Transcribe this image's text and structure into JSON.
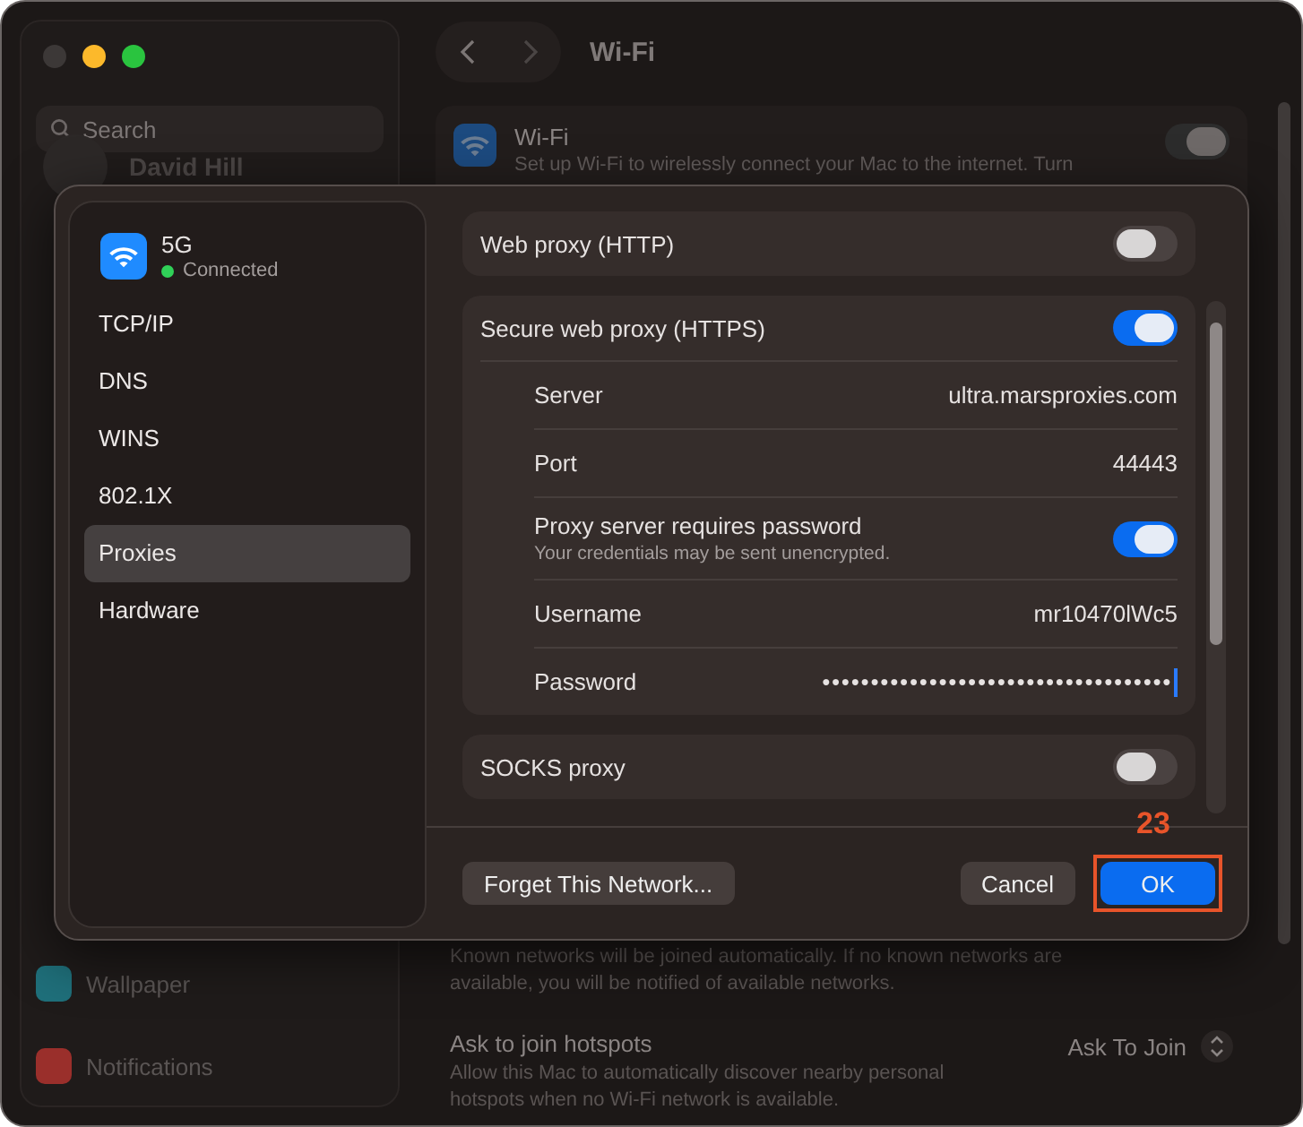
{
  "sidebar": {
    "search_placeholder": "Search",
    "account": "David Hill",
    "items": [
      {
        "label": "Wallpaper",
        "color": "#1f6f7a"
      },
      {
        "label": "Notifications",
        "color": "#9a2f2b"
      }
    ]
  },
  "toolbar": {
    "title": "Wi-Fi"
  },
  "wifi_card": {
    "title": "Wi-Fi",
    "description": "Set up Wi-Fi to wirelessly connect your Mac to the internet. Turn",
    "on": true
  },
  "auto_join_note": "Known networks will be joined automatically. If no known networks are available, you will be notified of available networks.",
  "hotspots": {
    "title": "Ask to join hotspots",
    "description": "Allow this Mac to automatically discover nearby personal hotspots when no Wi-Fi network is available.",
    "value": "Ask To Join"
  },
  "sheet": {
    "network": {
      "name": "5G",
      "status": "Connected",
      "color": "#30d158"
    },
    "tabs": [
      {
        "label": "TCP/IP",
        "selected": false
      },
      {
        "label": "DNS",
        "selected": false
      },
      {
        "label": "WINS",
        "selected": false
      },
      {
        "label": "802.1X",
        "selected": false
      },
      {
        "label": "Proxies",
        "selected": true
      },
      {
        "label": "Hardware",
        "selected": false
      }
    ],
    "proxies": [
      {
        "label": "Web proxy (HTTP)",
        "on": false
      },
      {
        "label": "Secure web proxy (HTTPS)",
        "on": true,
        "fields": [
          {
            "kind": "text",
            "label": "Server",
            "value": "ultra.marsproxies.com"
          },
          {
            "kind": "text",
            "label": "Port",
            "value": "44443"
          },
          {
            "kind": "toggle",
            "label": "Proxy server requires password",
            "note": "Your credentials may be sent unencrypted.",
            "on": true
          },
          {
            "kind": "text",
            "label": "Username",
            "value": "mr10470lWc5"
          },
          {
            "kind": "password",
            "label": "Password",
            "value": "●●●●●●●●●●●●●●●●●●●●●●●●●●●●●●●●●●●●"
          }
        ]
      },
      {
        "label": "SOCKS proxy",
        "on": false
      }
    ],
    "buttons": {
      "forget": "Forget This Network...",
      "cancel": "Cancel",
      "ok": "OK"
    },
    "annotation": "23"
  }
}
